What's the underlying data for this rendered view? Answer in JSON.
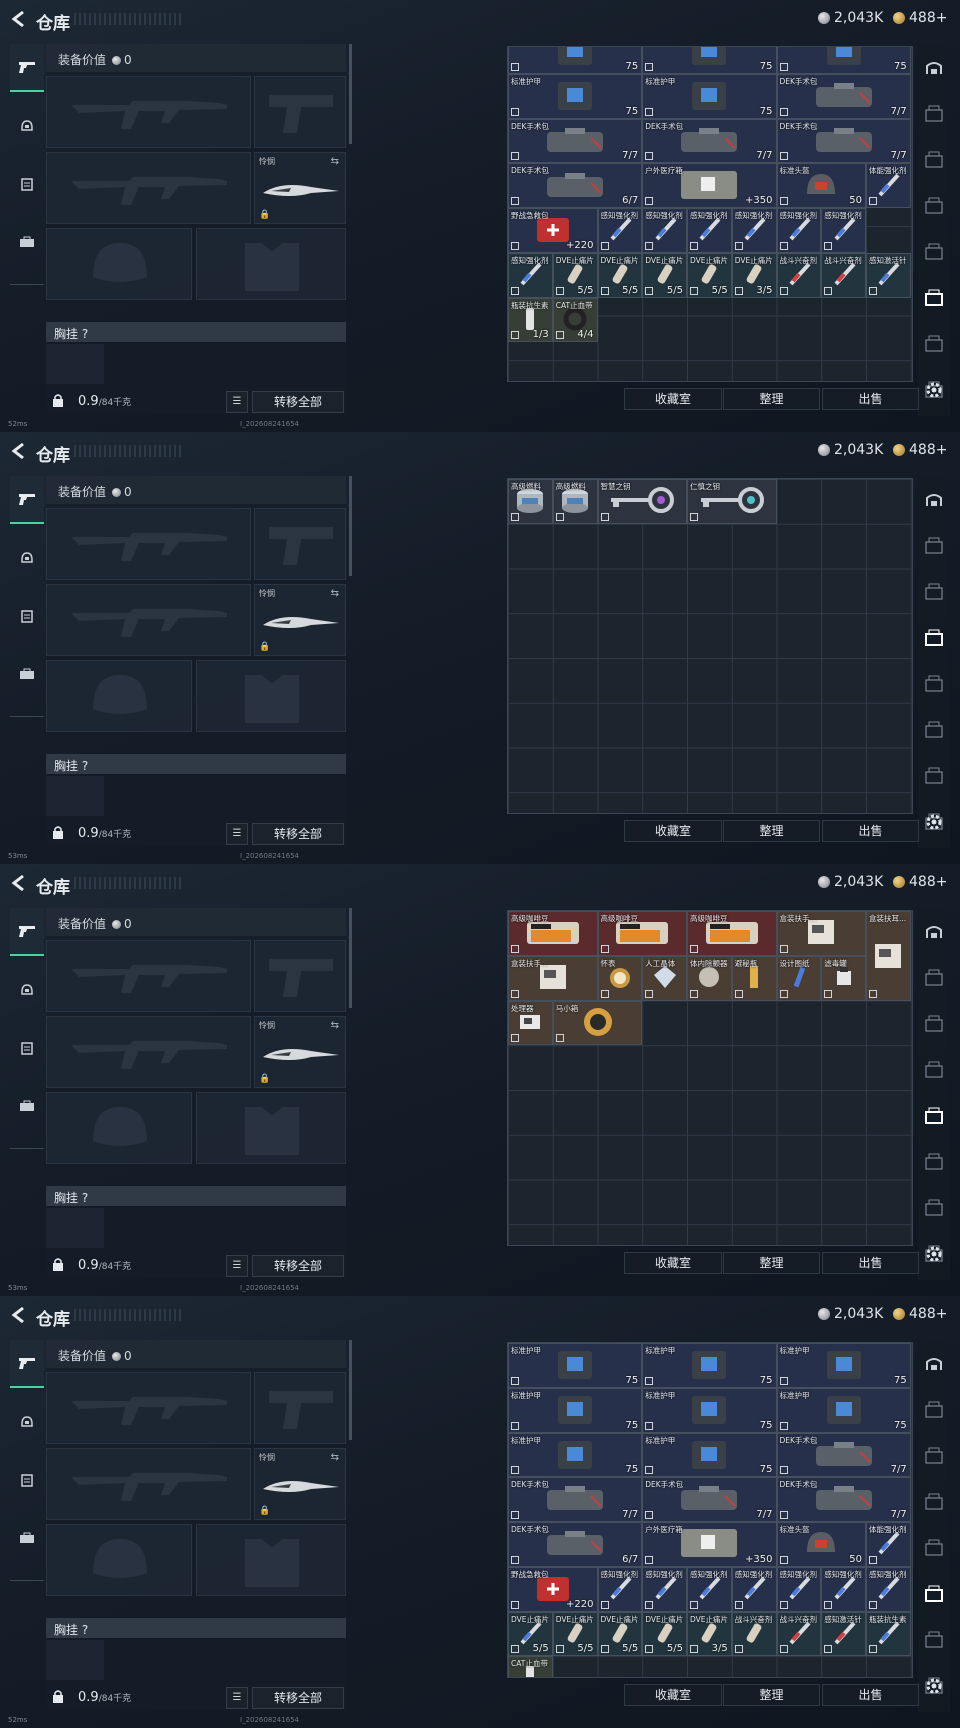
{
  "header": {
    "title": "仓库",
    "silver": "2,043K",
    "gold": "488+"
  },
  "left": {
    "equip_value_label": "装备价值",
    "equip_value": "0",
    "melee_label": "怜悯",
    "chest_label": "胸挂 ?",
    "weight": "0.9",
    "weight_cap": "/84千克",
    "transfer_all": "转移全部"
  },
  "buttons": {
    "collection": "收藏室",
    "sort": "整理",
    "sell": "出售"
  },
  "status": {
    "ping1": "53ms",
    "ping2": "53ms",
    "ping3": "52ms",
    "ping4": "52ms",
    "build": "I_202608241654"
  },
  "icons": {
    "back": "back-arrow-icon",
    "silver": "silver-coin-icon",
    "gold": "gold-coin-icon",
    "settings": "gear-icon"
  },
  "panels": [
    {
      "items": [
        {
          "name": "高级燃料",
          "qty": ""
        },
        {
          "name": "高级燃料",
          "qty": ""
        },
        {
          "name": "智慧之钥",
          "qty": ""
        },
        {
          "name": "仁慎之钥",
          "qty": ""
        }
      ]
    },
    {
      "items": [
        {
          "name": "高级咖啡豆",
          "qty": ""
        },
        {
          "name": "高级咖啡豆",
          "qty": ""
        },
        {
          "name": "高级咖啡豆",
          "qty": ""
        },
        {
          "name": "盒装扶手...",
          "qty": ""
        },
        {
          "name": "盒装扶耳...",
          "qty": ""
        },
        {
          "name": "盒装扶手...",
          "qty": ""
        },
        {
          "name": "怀表",
          "qty": ""
        },
        {
          "name": "人工晶体",
          "qty": ""
        },
        {
          "name": "体内除颤器",
          "qty": ""
        },
        {
          "name": "避秘瓶",
          "qty": ""
        },
        {
          "name": "设计图纸",
          "qty": ""
        },
        {
          "name": "滤毒罐",
          "qty": ""
        },
        {
          "name": "处理器",
          "qty": ""
        },
        {
          "name": "马小箱",
          "qty": ""
        }
      ]
    },
    {
      "items": [
        {
          "name": "标准护甲",
          "qty": "75"
        },
        {
          "name": "标准护甲",
          "qty": "75"
        },
        {
          "name": "标准护甲",
          "qty": "75"
        },
        {
          "name": "标准护甲",
          "qty": "75"
        },
        {
          "name": "标准护甲",
          "qty": "75"
        },
        {
          "name": "标准护甲",
          "qty": "75"
        },
        {
          "name": "标准护甲",
          "qty": "75"
        },
        {
          "name": "标准护甲",
          "qty": "75"
        },
        {
          "name": "DEK手术包",
          "qty": "7/7"
        },
        {
          "name": "DEK手术包",
          "qty": "7/7"
        },
        {
          "name": "DEK手术包",
          "qty": "7/7"
        },
        {
          "name": "DEK手术包",
          "qty": "7/7"
        },
        {
          "name": "DEK手术包",
          "qty": "6/7"
        },
        {
          "name": "户外医疗箱",
          "qty": "+350"
        },
        {
          "name": "标准头盔",
          "qty": "50"
        },
        {
          "name": "体能强化剂",
          "qty": ""
        },
        {
          "name": "野战急救包",
          "qty": "+220"
        },
        {
          "name": "感知强化剂",
          "qty": ""
        },
        {
          "name": "感知强化剂",
          "qty": ""
        },
        {
          "name": "感知强化剂",
          "qty": ""
        },
        {
          "name": "感知强化剂",
          "qty": ""
        },
        {
          "name": "感知强化剂",
          "qty": ""
        },
        {
          "name": "感知强化剂",
          "qty": ""
        },
        {
          "name": "感知强化剂",
          "qty": ""
        },
        {
          "name": "DVE止痛片",
          "qty": "5/5"
        },
        {
          "name": "DVE止痛片",
          "qty": "5/5"
        },
        {
          "name": "DVE止痛片",
          "qty": "5/5"
        },
        {
          "name": "DVE止痛片",
          "qty": "5/5"
        },
        {
          "name": "DVE止痛片",
          "qty": "3/5"
        },
        {
          "name": "战斗兴奋剂",
          "qty": ""
        },
        {
          "name": "战斗兴奋剂",
          "qty": ""
        },
        {
          "name": "感知激活针",
          "qty": ""
        },
        {
          "name": "瓶装抗生素",
          "qty": ""
        },
        {
          "name": "CAT止血带",
          "qty": ""
        }
      ]
    },
    {
      "items": [
        {
          "name": "",
          "qty": "75"
        },
        {
          "name": "",
          "qty": "75"
        },
        {
          "name": "",
          "qty": "75"
        },
        {
          "name": "标准护甲",
          "qty": "75"
        },
        {
          "name": "标准护甲",
          "qty": "75"
        },
        {
          "name": "DEK手术包",
          "qty": "7/7"
        },
        {
          "name": "DEK手术包",
          "qty": "7/7"
        },
        {
          "name": "DEK手术包",
          "qty": "7/7"
        },
        {
          "name": "DEK手术包",
          "qty": "7/7"
        },
        {
          "name": "DEK手术包",
          "qty": "6/7"
        },
        {
          "name": "户外医疗箱",
          "qty": "+350"
        },
        {
          "name": "标准头盔",
          "qty": "50"
        },
        {
          "name": "体能强化剂",
          "qty": ""
        },
        {
          "name": "野战急救包",
          "qty": "+220"
        },
        {
          "name": "感知强化剂",
          "qty": ""
        },
        {
          "name": "感知强化剂",
          "qty": ""
        },
        {
          "name": "感知强化剂",
          "qty": ""
        },
        {
          "name": "感知强化剂",
          "qty": ""
        },
        {
          "name": "感知强化剂",
          "qty": ""
        },
        {
          "name": "感知强化剂",
          "qty": ""
        },
        {
          "name": "感知强化剂",
          "qty": ""
        },
        {
          "name": "DVE止痛片",
          "qty": "5/5"
        },
        {
          "name": "DVE止痛片",
          "qty": "5/5"
        },
        {
          "name": "DVE止痛片",
          "qty": "5/5"
        },
        {
          "name": "DVE止痛片",
          "qty": "5/5"
        },
        {
          "name": "DVE止痛片",
          "qty": "3/5"
        },
        {
          "name": "战斗兴奋剂",
          "qty": ""
        },
        {
          "name": "战斗兴奋剂",
          "qty": ""
        },
        {
          "name": "感知激活针",
          "qty": ""
        },
        {
          "name": "瓶装抗生素",
          "qty": "1/3"
        },
        {
          "name": "CAT止血带",
          "qty": "4/4"
        }
      ]
    }
  ]
}
